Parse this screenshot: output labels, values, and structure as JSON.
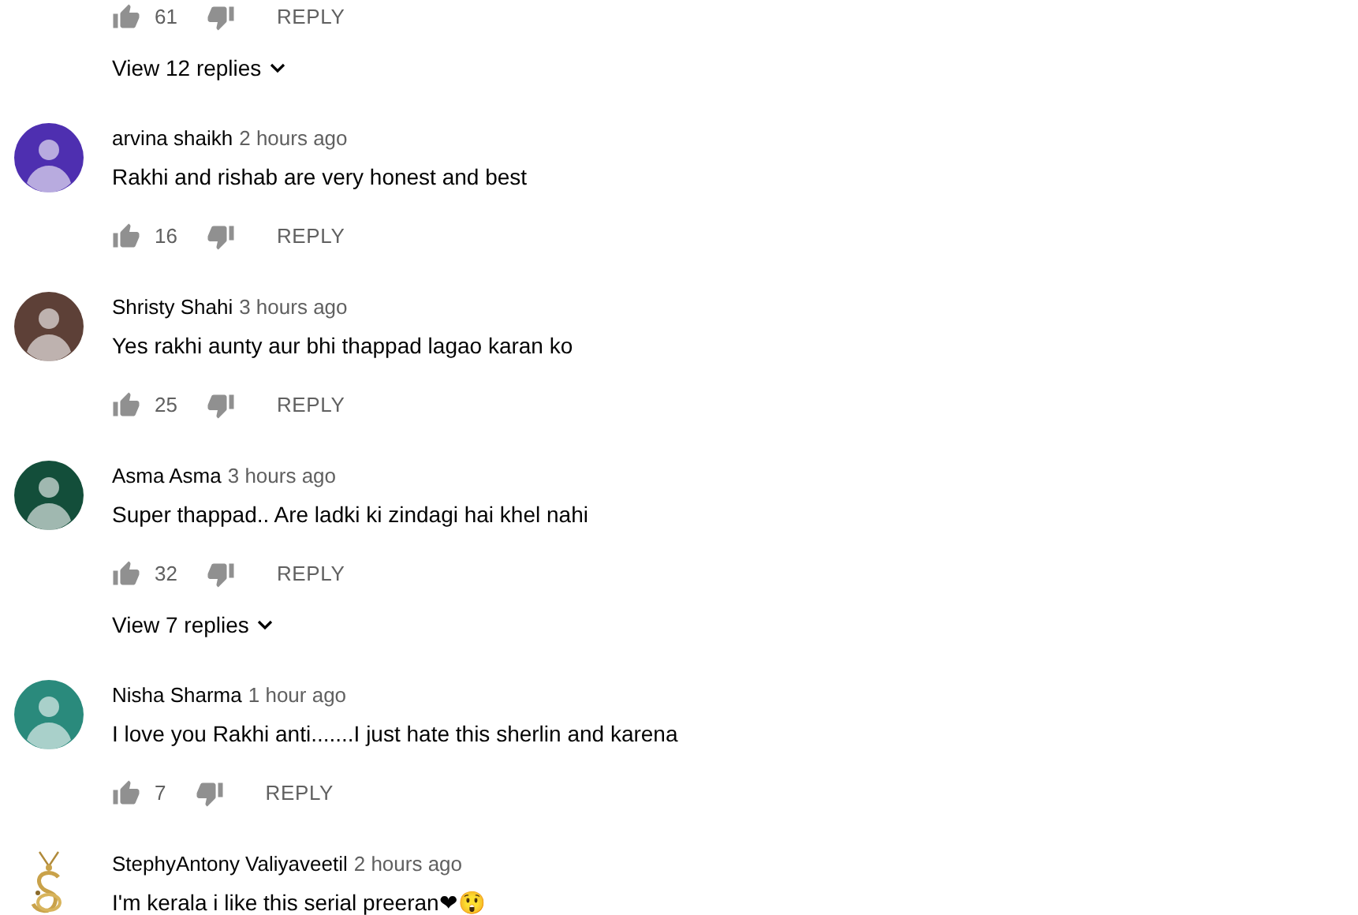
{
  "top_thread": {
    "likes": "61",
    "reply_label": "REPLY",
    "replies_link": "View 12 replies"
  },
  "comments": [
    {
      "author": "arvina shaikh",
      "time": "2 hours ago",
      "text": "Rakhi and rishab are very honest and best",
      "likes": "16",
      "reply_label": "REPLY",
      "avatar": {
        "kind": "default",
        "color": "#4e2fb0"
      }
    },
    {
      "author": "Shristy Shahi",
      "time": "3 hours ago",
      "text": "Yes rakhi aunty aur bhi thappad lagao karan ko",
      "likes": "25",
      "reply_label": "REPLY",
      "avatar": {
        "kind": "default",
        "color": "#5d4037"
      }
    },
    {
      "author": "Asma Asma",
      "time": "3 hours ago",
      "text": "Super thappad.. Are ladki ki zindagi hai khel nahi",
      "likes": "32",
      "reply_label": "REPLY",
      "replies_link": "View 7 replies",
      "avatar": {
        "kind": "default",
        "color": "#134e3a"
      }
    },
    {
      "author": "Nisha Sharma",
      "time": "1 hour ago",
      "text": "I love you Rakhi anti.......I just hate this sherlin and karena",
      "likes": "7",
      "reply_label": "REPLY",
      "avatar": {
        "kind": "default",
        "color": "#2a8a7c"
      }
    },
    {
      "author": "StephyAntony Valiyaveetil",
      "time": "2 hours ago",
      "text": "I'm kerala i like this serial preeran❤😲"
    }
  ]
}
